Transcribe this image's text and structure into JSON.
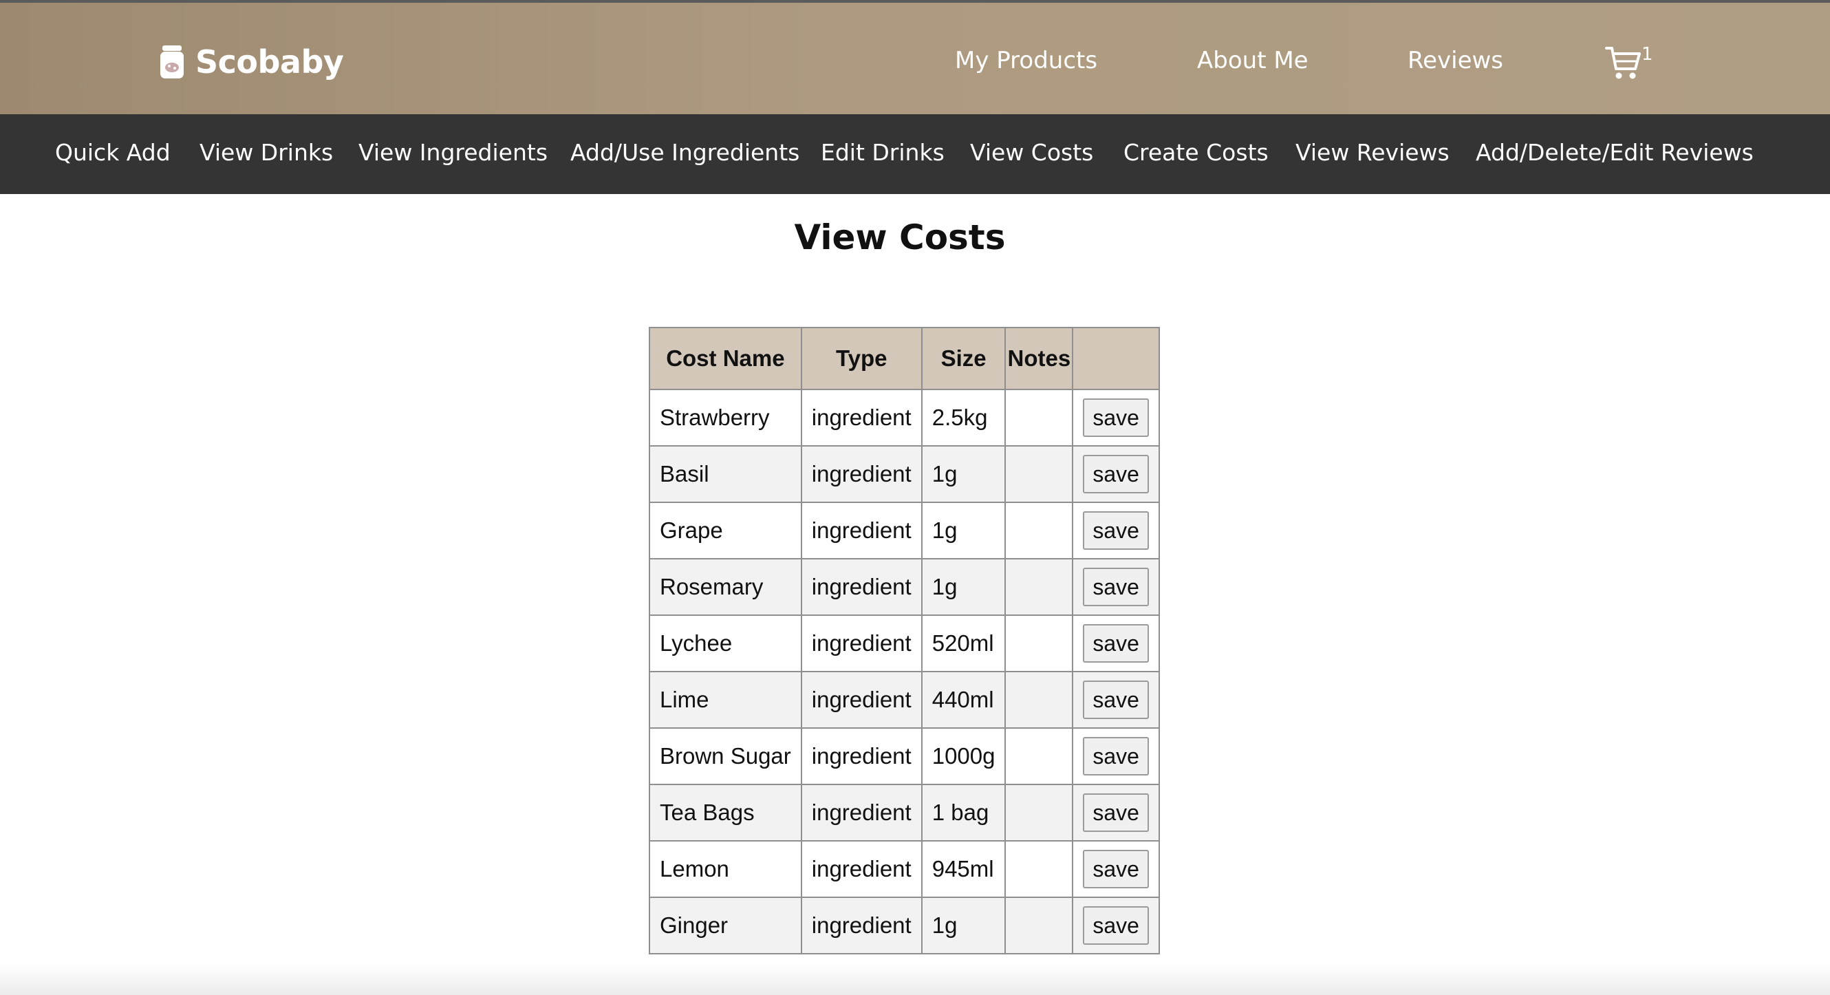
{
  "header": {
    "brand_name": "Scobaby",
    "brand_icon": "jar-icon",
    "nav": [
      {
        "label": "My Products"
      },
      {
        "label": "About Me"
      },
      {
        "label": "Reviews"
      }
    ],
    "cart_count": "1",
    "colors": {
      "header_bg": "#a8957a",
      "subnav_bg": "#343434",
      "table_header_bg": "#d3c7b9"
    }
  },
  "subnav": {
    "items": [
      {
        "label": "Quick Add"
      },
      {
        "label": "View Drinks"
      },
      {
        "label": "View Ingredients"
      },
      {
        "label": "Add/Use Ingredients"
      },
      {
        "label": "Edit Drinks"
      },
      {
        "label": "View Costs"
      },
      {
        "label": "Create Costs"
      },
      {
        "label": "View Reviews"
      },
      {
        "label": "Add/Delete/Edit Reviews"
      }
    ]
  },
  "main": {
    "title": "View Costs",
    "table": {
      "headers": [
        "Cost Name",
        "Type",
        "Size",
        "Notes",
        ""
      ],
      "rows": [
        {
          "name": "Strawberry",
          "type": "ingredient",
          "size": "2.5kg",
          "notes": "",
          "action": "save"
        },
        {
          "name": "Basil",
          "type": "ingredient",
          "size": "1g",
          "notes": "",
          "action": "save"
        },
        {
          "name": "Grape",
          "type": "ingredient",
          "size": "1g",
          "notes": "",
          "action": "save"
        },
        {
          "name": "Rosemary",
          "type": "ingredient",
          "size": "1g",
          "notes": "",
          "action": "save"
        },
        {
          "name": "Lychee",
          "type": "ingredient",
          "size": "520ml",
          "notes": "",
          "action": "save"
        },
        {
          "name": "Lime",
          "type": "ingredient",
          "size": "440ml",
          "notes": "",
          "action": "save"
        },
        {
          "name": "Brown Sugar",
          "type": "ingredient",
          "size": "1000g",
          "notes": "",
          "action": "save"
        },
        {
          "name": "Tea Bags",
          "type": "ingredient",
          "size": "1 bag",
          "notes": "",
          "action": "save"
        },
        {
          "name": "Lemon",
          "type": "ingredient",
          "size": "945ml",
          "notes": "",
          "action": "save"
        },
        {
          "name": "Ginger",
          "type": "ingredient",
          "size": "1g",
          "notes": "",
          "action": "save"
        }
      ]
    }
  }
}
